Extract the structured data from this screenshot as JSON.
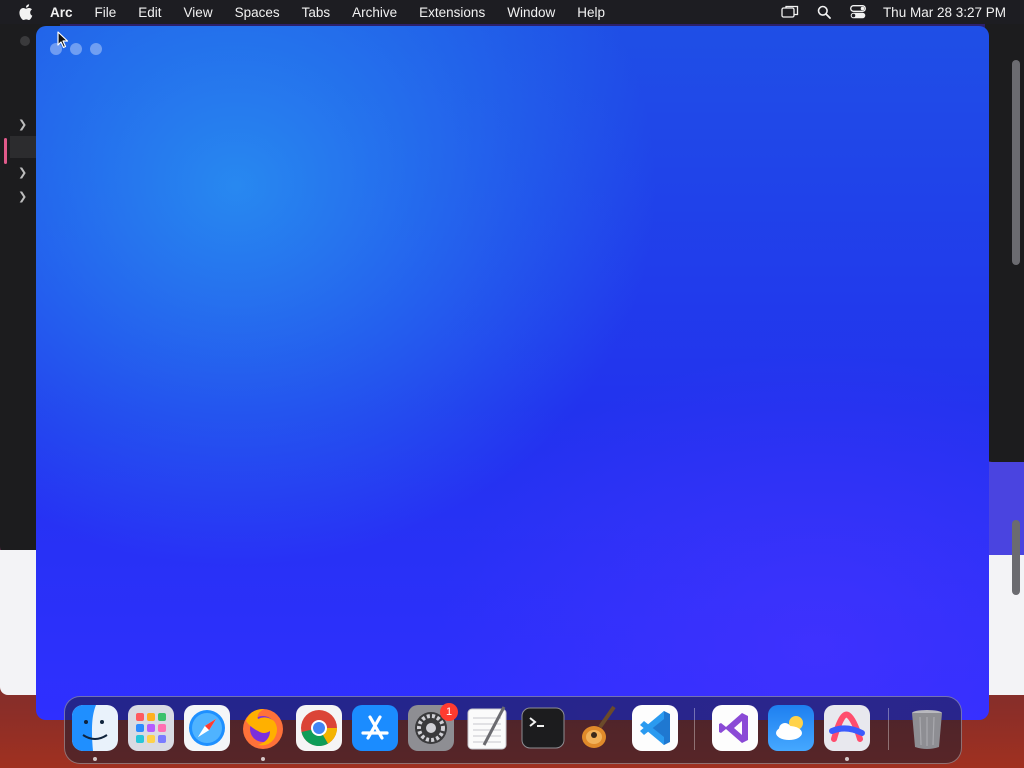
{
  "menubar": {
    "app_name": "Arc",
    "menus": [
      "File",
      "Edit",
      "View",
      "Spaces",
      "Tabs",
      "Archive",
      "Extensions",
      "Window",
      "Help"
    ],
    "status_icons": [
      "screen-mirroring-icon",
      "spotlight-search-icon",
      "control-center-icon"
    ],
    "clock": "Thu Mar 28  3:27 PM"
  },
  "window": {
    "app": "Arc",
    "state": "blank-new-window",
    "background_colors": [
      "#2aa0f2",
      "#1f4fe6",
      "#2f2fff"
    ]
  },
  "dock": {
    "apps": [
      {
        "name": "Finder",
        "icon": "finder-icon",
        "running": true
      },
      {
        "name": "Launchpad",
        "icon": "launchpad-icon",
        "running": false
      },
      {
        "name": "Safari",
        "icon": "safari-icon",
        "running": false
      },
      {
        "name": "Firefox",
        "icon": "firefox-icon",
        "running": true
      },
      {
        "name": "Google Chrome",
        "icon": "chrome-icon",
        "running": false
      },
      {
        "name": "App Store",
        "icon": "app-store-icon",
        "running": false
      },
      {
        "name": "System Settings",
        "icon": "system-settings-icon",
        "running": false,
        "badge": "1"
      },
      {
        "name": "TextEdit",
        "icon": "textedit-icon",
        "running": false
      },
      {
        "name": "Terminal",
        "icon": "terminal-icon",
        "running": false
      },
      {
        "name": "GarageBand",
        "icon": "garageband-icon",
        "running": false
      },
      {
        "name": "Visual Studio Code",
        "icon": "vscode-icon",
        "running": false
      },
      {
        "name": "Visual Studio",
        "icon": "visual-studio-icon",
        "running": false
      },
      {
        "name": "Weather",
        "icon": "weather-icon",
        "running": false
      },
      {
        "name": "Arc",
        "icon": "arc-icon",
        "running": true
      },
      {
        "name": "Trash",
        "icon": "trash-icon",
        "running": false
      }
    ]
  }
}
